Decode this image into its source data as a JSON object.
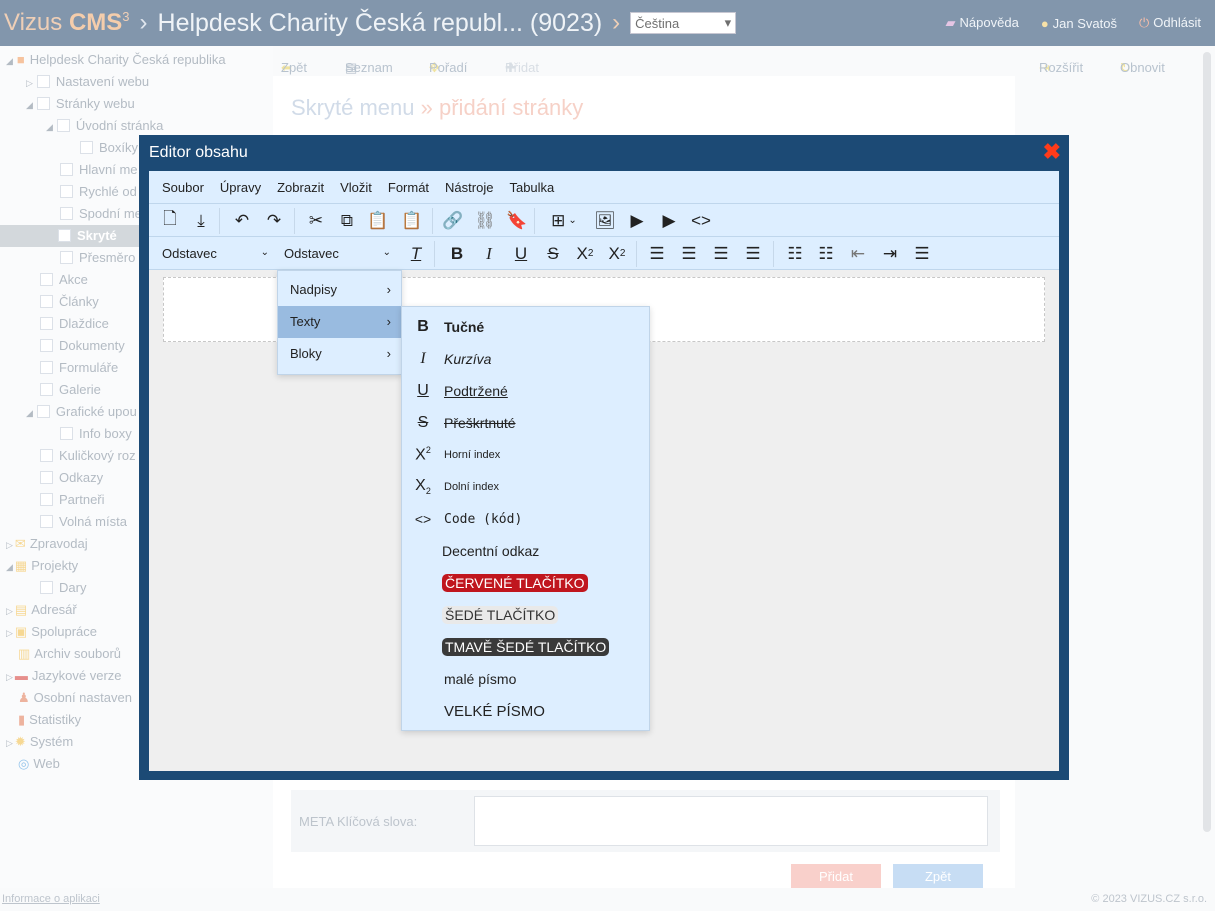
{
  "header": {
    "brand_vizus": "Vizus",
    "brand_cms": "CMS",
    "brand_sup": "3",
    "site_title": "Helpdesk Charity Česká republ... (9023)",
    "language": "Čeština",
    "help": "Nápověda",
    "user": "Jan Svatoš",
    "logout": "Odhlásit"
  },
  "sidebar": {
    "items": [
      "Helpdesk Charity Česká republika",
      "Nastavení webu",
      "Stránky webu",
      "Úvodní stránka",
      "Boxíky",
      "Hlavní me",
      "Rychlé od",
      "Spodní me",
      "Skryté",
      "Přesměro",
      "Akce",
      "Články",
      "Dlaždice",
      "Dokumenty",
      "Formuláře",
      "Galerie",
      "Grafické upou",
      "Info boxy",
      "Kuličkový roz",
      "Odkazy",
      "Partneři",
      "Volná místa",
      "Zpravodaj",
      "Projekty",
      "Dary",
      "Adresář",
      "Spolupráce",
      "Archiv souborů",
      "Jazykové verze",
      "Osobní nastaven",
      "Statistiky",
      "Systém",
      "Web"
    ]
  },
  "toolbar": {
    "back": "Zpět",
    "list": "Seznam",
    "order": "Pořadí",
    "add": "Přidat",
    "expand": "Rozšířit",
    "refresh": "Obnovit"
  },
  "page": {
    "heading": "Skryté menu",
    "heading_sep": "»",
    "heading_accent": "přidání stránky",
    "meta_keywords_label": "META Klíčová slova:",
    "add_button": "Přidat",
    "back_button": "Zpět"
  },
  "footer": {
    "info_link": "Informace o aplikaci",
    "copyright": "© 2023 VIZUS.CZ s.r.o."
  },
  "editor": {
    "title": "Editor obsahu",
    "menubar": [
      "Soubor",
      "Úpravy",
      "Zobrazit",
      "Vložit",
      "Formát",
      "Nástroje",
      "Tabulka"
    ],
    "block_select": "Odstavec",
    "format_select": "Odstavec",
    "format_menu": [
      "Nadpisy",
      "Texty",
      "Bloky"
    ],
    "texts_menu": [
      "Tučné",
      "Kurzíva",
      "Podtržené",
      "Přeškrtnuté",
      "Horní index",
      "Dolní index",
      "Code (kód)",
      "Decentní odkaz",
      "ČERVENÉ TLAČÍTKO",
      "ŠEDÉ TLAČÍTKO",
      "TMAVĚ ŠEDÉ TLAČÍTKO",
      "malé písmo",
      "VELKÉ PÍSMO"
    ]
  },
  "colors": {
    "topbar": "#3f5f80",
    "modal": "#1c4a75",
    "toolbar_bg": "#ddeeff",
    "active_item": "#99bbe0",
    "red_button": "#c0161e",
    "grey_button": "#e9e9e9",
    "dark_grey_button": "#3a3a3a",
    "close_icon": "#ff3b1a"
  }
}
